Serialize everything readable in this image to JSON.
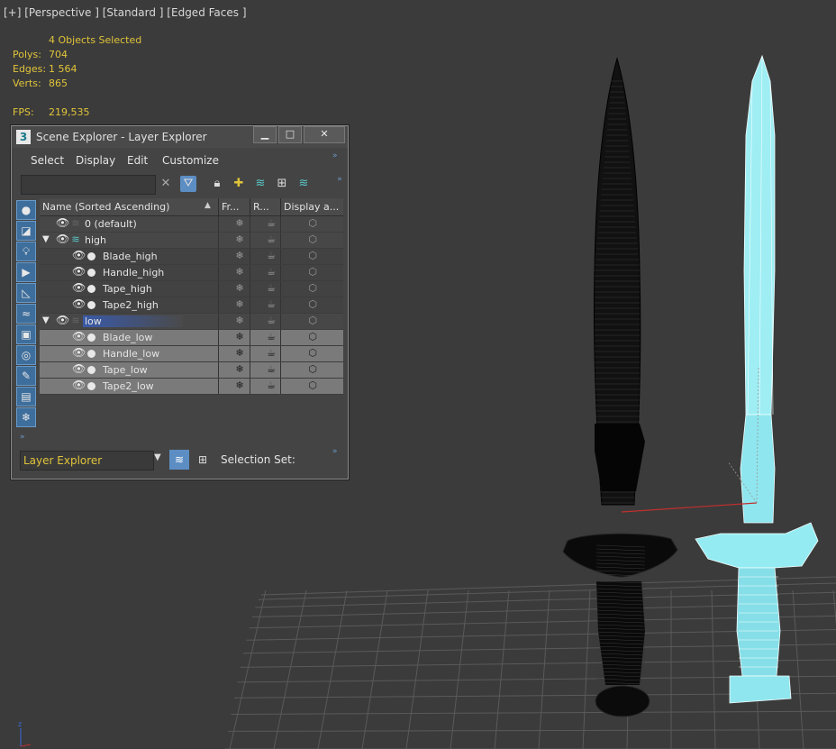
{
  "viewport": {
    "label": "[+] [Perspective ] [Standard ] [Edged Faces ]",
    "selection_text": "4 Objects Selected",
    "stats": [
      {
        "key": "Polys:",
        "value": "704"
      },
      {
        "key": "Edges:",
        "value": "1 564"
      },
      {
        "key": "Verts:",
        "value": "865"
      }
    ],
    "fps": {
      "key": "FPS:",
      "value": "219,535"
    },
    "colors": {
      "background": "#3b3b3b",
      "stats_text": "#e0c43a",
      "grid": "#5a5a5a",
      "selected_mesh": "#8fe8f0",
      "wire_mesh": "#0e0e0e"
    }
  },
  "explorer": {
    "app_icon": "3",
    "title": "Scene Explorer - Layer Explorer",
    "window_buttons": [
      "minimize-icon",
      "maximize-icon",
      "close-icon"
    ],
    "menu": [
      "Select",
      "Display",
      "Edit",
      "Customize"
    ],
    "search_placeholder": "",
    "columns": [
      "Name (Sorted Ascending)",
      "Fr...",
      "R...",
      "Display a..."
    ],
    "rows": [
      {
        "name": "0 (default)",
        "level": 0,
        "kind": "layer",
        "expanded": null,
        "selected": false
      },
      {
        "name": "high",
        "level": 0,
        "kind": "layer",
        "expanded": true,
        "selected": false
      },
      {
        "name": "Blade_high",
        "level": 1,
        "kind": "object",
        "selected": false
      },
      {
        "name": "Handle_high",
        "level": 1,
        "kind": "object",
        "selected": false
      },
      {
        "name": "Tape_high",
        "level": 1,
        "kind": "object",
        "selected": false
      },
      {
        "name": "Tape2_high",
        "level": 1,
        "kind": "object",
        "selected": false
      },
      {
        "name": "low",
        "level": 0,
        "kind": "layer",
        "expanded": true,
        "selected": false,
        "current": true
      },
      {
        "name": "Blade_low",
        "level": 1,
        "kind": "object",
        "selected": true
      },
      {
        "name": "Handle_low",
        "level": 1,
        "kind": "object",
        "selected": true
      },
      {
        "name": "Tape_low",
        "level": 1,
        "kind": "object",
        "selected": true
      },
      {
        "name": "Tape2_low",
        "level": 1,
        "kind": "object",
        "selected": true
      }
    ],
    "bottom": {
      "explorer_name": "Layer Explorer",
      "selection_set_label": "Selection Set:"
    }
  }
}
